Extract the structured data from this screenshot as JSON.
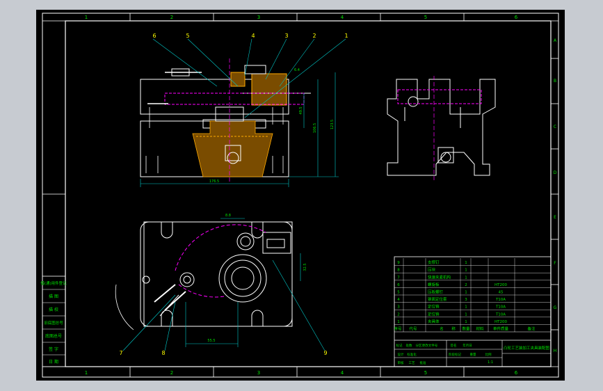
{
  "colors": {
    "background": "#c7cbd1",
    "sheet": "#000000",
    "border": "#ffffff",
    "ruler_text": "#00e000",
    "leader": "#00c8c8",
    "part_numbers": "#ffff00",
    "hidden_lines": "#ff00ff",
    "hatch": "#ffaa00",
    "table_text": "#00e000"
  },
  "zone_columns": [
    "1",
    "2",
    "3",
    "4",
    "5",
    "6"
  ],
  "zone_rows": [
    "A",
    "B",
    "C",
    "D",
    "E",
    "F",
    "G",
    "H"
  ],
  "part_callouts_top": [
    "6",
    "5",
    "4",
    "3",
    "2",
    "1"
  ],
  "part_callouts_bottom": [
    "7",
    "8",
    "9"
  ],
  "dimensions": {
    "width_front": "176.5",
    "height_outer": "123.5",
    "height_mid": "106.5",
    "height_inner": "49.5",
    "plan_width": "55.5",
    "plan_top": "8.8",
    "plan_right": "32.5",
    "small_top": "6.4"
  },
  "parts_list": [
    {
      "no": "9",
      "name": "支撑钉",
      "qty": "1",
      "material": ""
    },
    {
      "no": "8",
      "name": "压块",
      "qty": "1",
      "material": ""
    },
    {
      "no": "7",
      "name": "快速夹紧机构",
      "qty": "1",
      "material": ""
    },
    {
      "no": "6",
      "name": "螺旋板",
      "qty": "2",
      "material": "HT200"
    },
    {
      "no": "5",
      "name": "压板螺钉",
      "qty": "1",
      "material": "45"
    },
    {
      "no": "4",
      "name": "锥面定位套",
      "qty": "3",
      "material": "T10A"
    },
    {
      "no": "3",
      "name": "定位销",
      "qty": "1",
      "material": "T10A"
    },
    {
      "no": "2",
      "name": "定位销",
      "qty": "1",
      "material": "T10A"
    },
    {
      "no": "1",
      "name": "夹具体",
      "qty": "1",
      "material": "HT200"
    }
  ],
  "parts_header": [
    "序号",
    "代号",
    "名",
    "称",
    "数量",
    "材料",
    "单件质量",
    "备注"
  ],
  "title_block": {
    "drawing_title": "凸轮工艺装加工夹具装配图",
    "cells": [
      "标记",
      "处数",
      "分区",
      "更改文件号",
      "签名",
      "年月日",
      "设计",
      "标准化",
      "阶段标记",
      "重量",
      "比例",
      "审核",
      "工艺",
      "批准"
    ],
    "scale": "1:1"
  },
  "left_panel": [
    "借(通)用件登记",
    "描 图",
    "描 校",
    "旧底图总号",
    "底图总号",
    "签 字",
    "日 期"
  ]
}
